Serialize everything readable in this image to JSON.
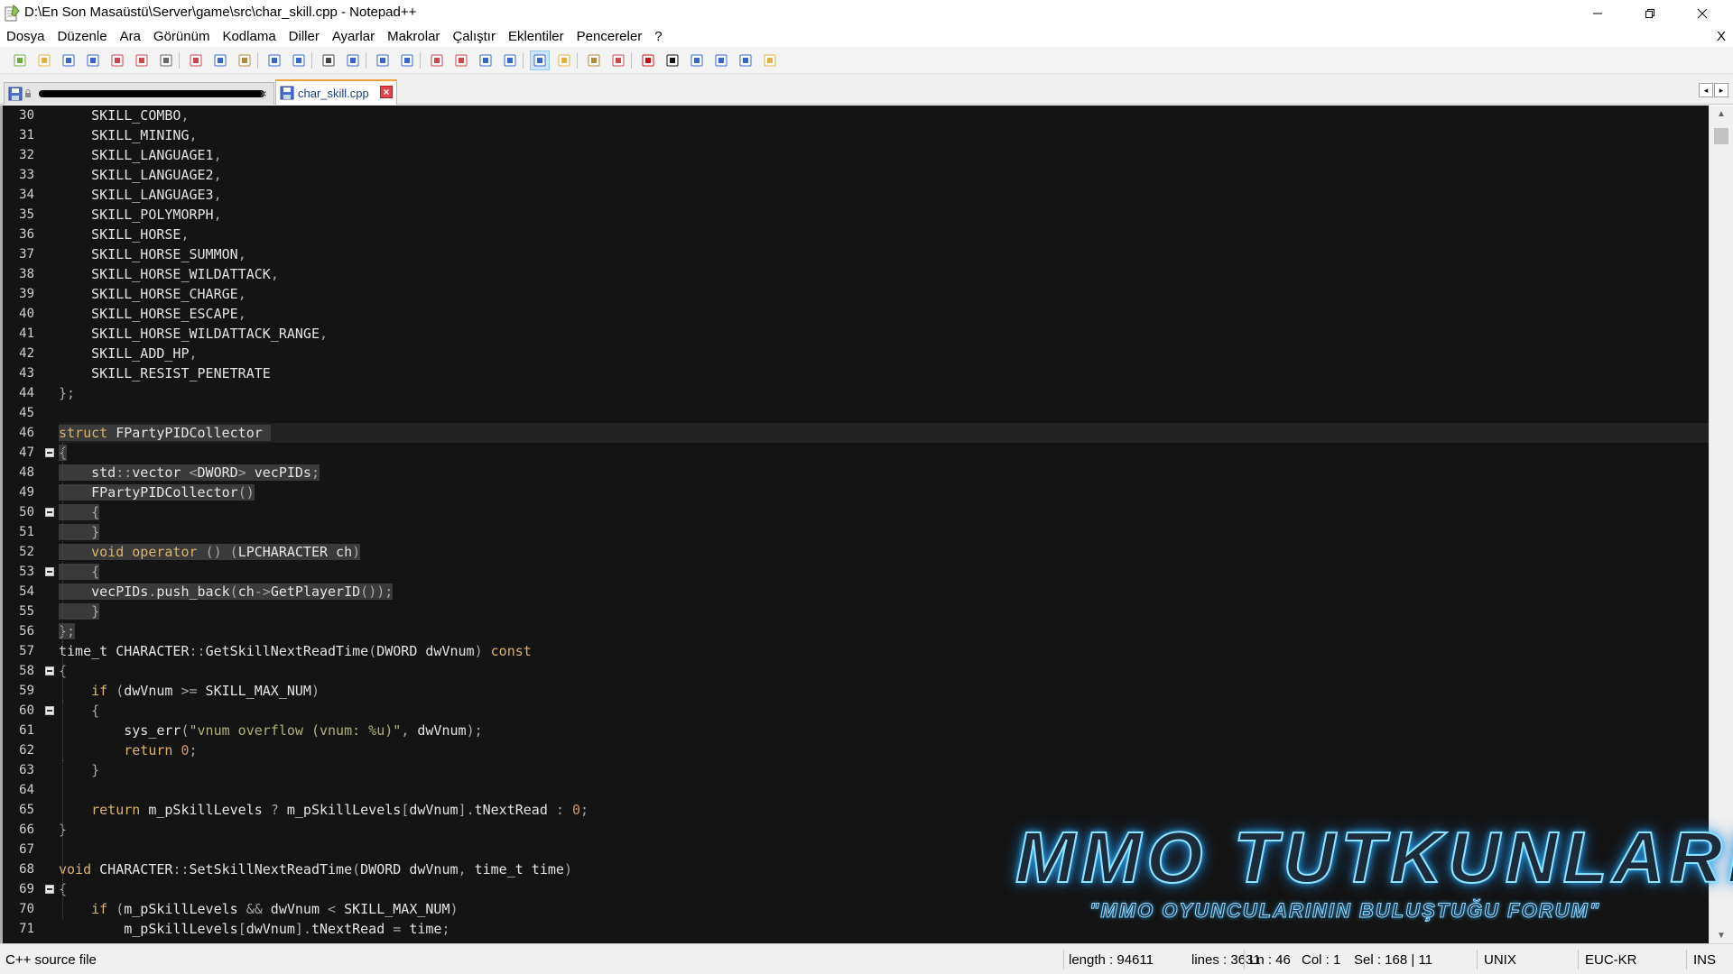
{
  "window": {
    "title": "D:\\En Son Masaüstü\\Server\\game\\src\\char_skill.cpp - Notepad++",
    "app_icon": "notepad-icon",
    "controls": {
      "minimize": "minimize-icon",
      "maximize": "restore-icon",
      "close": "close-icon"
    }
  },
  "menu": {
    "items": [
      "Dosya",
      "Düzenle",
      "Ara",
      "Görünüm",
      "Kodlama",
      "Diller",
      "Ayarlar",
      "Makrolar",
      "Çalıştır",
      "Eklentiler",
      "Pencereler",
      "?"
    ],
    "close_doc": "X"
  },
  "toolbar": {
    "icons": [
      "new-file-icon",
      "open-file-icon",
      "save-icon",
      "save-all-icon",
      "close-icon",
      "close-all-icon",
      "print-icon",
      "cut-icon",
      "copy-icon",
      "paste-icon",
      "undo-icon",
      "redo-icon",
      "find-icon",
      "replace-icon",
      "zoom-in-icon",
      "zoom-out-icon",
      "sync-vertical-icon",
      "sync-horizontal-icon",
      "word-wrap-icon",
      "show-all-chars-icon",
      "indent-guide-icon",
      "function-list-icon",
      "folder-workspace-icon",
      "document-map-icon",
      "record-macro-icon",
      "stop-record-icon",
      "play-macro-icon",
      "run-macro-multiple-icon",
      "save-macro-icon",
      "spellcheck-icon"
    ]
  },
  "tabs": [
    {
      "label": "",
      "redacted": true,
      "close": "×"
    },
    {
      "label": "char_skill.cpp",
      "active": true,
      "close": "×"
    }
  ],
  "tab_nav": {
    "left": "◂",
    "right": "▸"
  },
  "editor": {
    "lines": [
      {
        "n": "30",
        "text": "    SKILL_COMBO,"
      },
      {
        "n": "31",
        "text": "    SKILL_MINING,"
      },
      {
        "n": "32",
        "text": "    SKILL_LANGUAGE1,"
      },
      {
        "n": "33",
        "text": "    SKILL_LANGUAGE2,"
      },
      {
        "n": "34",
        "text": "    SKILL_LANGUAGE3,"
      },
      {
        "n": "35",
        "text": "    SKILL_POLYMORPH,"
      },
      {
        "n": "36",
        "text": "    SKILL_HORSE,"
      },
      {
        "n": "37",
        "text": "    SKILL_HORSE_SUMMON,"
      },
      {
        "n": "38",
        "text": "    SKILL_HORSE_WILDATTACK,"
      },
      {
        "n": "39",
        "text": "    SKILL_HORSE_CHARGE,"
      },
      {
        "n": "40",
        "text": "    SKILL_HORSE_ESCAPE,"
      },
      {
        "n": "41",
        "text": "    SKILL_HORSE_WILDATTACK_RANGE,"
      },
      {
        "n": "42",
        "text": "    SKILL_ADD_HP,"
      },
      {
        "n": "43",
        "text": "    SKILL_RESIST_PENETRATE"
      },
      {
        "n": "44",
        "text": "};"
      },
      {
        "n": "45",
        "text": ""
      },
      {
        "n": "46",
        "text": "struct FPartyPIDCollector ",
        "current": true,
        "selected": true
      },
      {
        "n": "47",
        "text": "{",
        "fold": true,
        "selected": true
      },
      {
        "n": "48",
        "text": "    std::vector <DWORD> vecPIDs;",
        "selected": true
      },
      {
        "n": "49",
        "text": "    FPartyPIDCollector()",
        "selected": true
      },
      {
        "n": "50",
        "text": "    {",
        "fold": true,
        "selected": true
      },
      {
        "n": "51",
        "text": "    }",
        "selected": true
      },
      {
        "n": "52",
        "text": "    void operator () (LPCHARACTER ch)",
        "selected": true
      },
      {
        "n": "53",
        "text": "    {",
        "fold": true,
        "selected": true
      },
      {
        "n": "54",
        "text": "    vecPIDs.push_back(ch->GetPlayerID());",
        "selected": true
      },
      {
        "n": "55",
        "text": "    }",
        "selected": true
      },
      {
        "n": "56",
        "text": "};",
        "selected": true
      },
      {
        "n": "57",
        "text": "time_t CHARACTER::GetSkillNextReadTime(DWORD dwVnum) const"
      },
      {
        "n": "58",
        "text": "{",
        "fold": true
      },
      {
        "n": "59",
        "text": "    if (dwVnum >= SKILL_MAX_NUM)"
      },
      {
        "n": "60",
        "text": "    {",
        "fold": true
      },
      {
        "n": "61",
        "text": "        sys_err(\"vnum overflow (vnum: %u)\", dwVnum);"
      },
      {
        "n": "62",
        "text": "        return 0;"
      },
      {
        "n": "63",
        "text": "    }"
      },
      {
        "n": "64",
        "text": ""
      },
      {
        "n": "65",
        "text": "    return m_pSkillLevels ? m_pSkillLevels[dwVnum].tNextRead : 0;"
      },
      {
        "n": "66",
        "text": "}"
      },
      {
        "n": "67",
        "text": ""
      },
      {
        "n": "68",
        "text": "void CHARACTER::SetSkillNextReadTime(DWORD dwVnum, time_t time)"
      },
      {
        "n": "69",
        "text": "{",
        "fold": true
      },
      {
        "n": "70",
        "text": "    if (m_pSkillLevels && dwVnum < SKILL_MAX_NUM)"
      },
      {
        "n": "71",
        "text": "        m_pSkillLevels[dwVnum].tNextRead = time;"
      }
    ],
    "colors": {
      "background": "#141414",
      "keyword": "#dcb36a",
      "text": "#e4e4e4",
      "selection": "#3a3a3a"
    }
  },
  "scrollbar": {
    "position": 0.008,
    "visible_fraction": 0.012,
    "up": "▲",
    "down": "▼"
  },
  "watermark": {
    "title": "MMO TUTKUNLARI",
    "subtitle": "\"MMO OYUNCULARININ BULUŞTUĞU FORUM\""
  },
  "status": {
    "file_type": "C++ source file",
    "length": "length : 94611",
    "lines": "lines : 3631",
    "ln": "Ln : 46",
    "col": "Col : 1",
    "sel": "Sel : 168 | 11",
    "eol": "UNIX",
    "encoding": "EUC-KR",
    "mode": "INS"
  }
}
